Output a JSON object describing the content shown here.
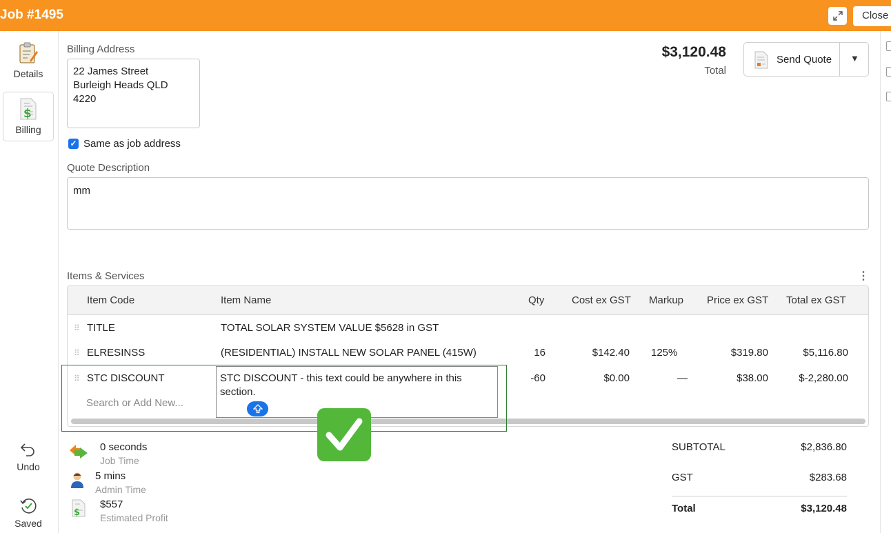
{
  "window": {
    "title": "Job #1495",
    "close_label": "Close",
    "expand_icon": "expand-icon"
  },
  "sidebar": {
    "top_items": [
      {
        "label": "Details",
        "icon": "clipboard-edit-icon"
      },
      {
        "label": "Billing",
        "icon": "invoice-dollar-icon",
        "active": true
      }
    ],
    "bottom_items": [
      {
        "label": "Undo",
        "icon": "undo-arrow-icon"
      },
      {
        "label": "Saved",
        "icon": "saved-check-icon"
      }
    ]
  },
  "billing": {
    "address_label": "Billing Address",
    "address_lines": [
      "22 James Street",
      "Burleigh Heads QLD",
      "4220"
    ],
    "same_as_job_label": "Same as job address",
    "same_as_job_checked": true,
    "description_label": "Quote Description",
    "description_value": "mm"
  },
  "summary": {
    "total_amount": "$3,120.48",
    "total_caption": "Total",
    "send_quote_label": "Send Quote"
  },
  "items": {
    "section_label": "Items & Services",
    "columns": [
      "Item Code",
      "Item Name",
      "Qty",
      "Cost ex GST",
      "Markup",
      "Price ex GST",
      "Total ex GST"
    ],
    "rows": [
      {
        "code": "TITLE",
        "name": "TOTAL SOLAR SYSTEM VALUE $5628 in GST",
        "qty": "",
        "cost": "",
        "markup": "",
        "price": "",
        "total": ""
      },
      {
        "code": "ELRESINSS",
        "name": "(RESIDENTIAL) INSTALL NEW SOLAR PANEL (415W)",
        "qty": "16",
        "cost": "$142.40",
        "markup": "125%",
        "price": "$319.80",
        "total": "$5,116.80"
      },
      {
        "code": "STC DISCOUNT",
        "name": "STC DISCOUNT - this text could be anywhere in this section.",
        "qty": "-60",
        "cost": "$0.00",
        "markup": "—",
        "price": "$38.00",
        "total": "$-2,280.00"
      }
    ],
    "search_placeholder": "Search or Add New..."
  },
  "stats": [
    {
      "value": "0 seconds",
      "caption": "Job Time",
      "icon": "swap-arrows-icon"
    },
    {
      "value": "5 mins",
      "caption": "Admin Time",
      "icon": "person-icon"
    },
    {
      "value": "$557",
      "caption": "Estimated Profit",
      "icon": "invoice-dollar-icon"
    }
  ],
  "totals": {
    "subtotal_label": "SUBTOTAL",
    "subtotal_value": "$2,836.80",
    "gst_label": "GST",
    "gst_value": "$283.68",
    "total_label": "Total",
    "total_value": "$3,120.48"
  },
  "colors": {
    "header": "#f7931e",
    "accent_blue": "#1a73e8",
    "check_green": "#53b83a",
    "frame_green": "#2e7d32"
  }
}
